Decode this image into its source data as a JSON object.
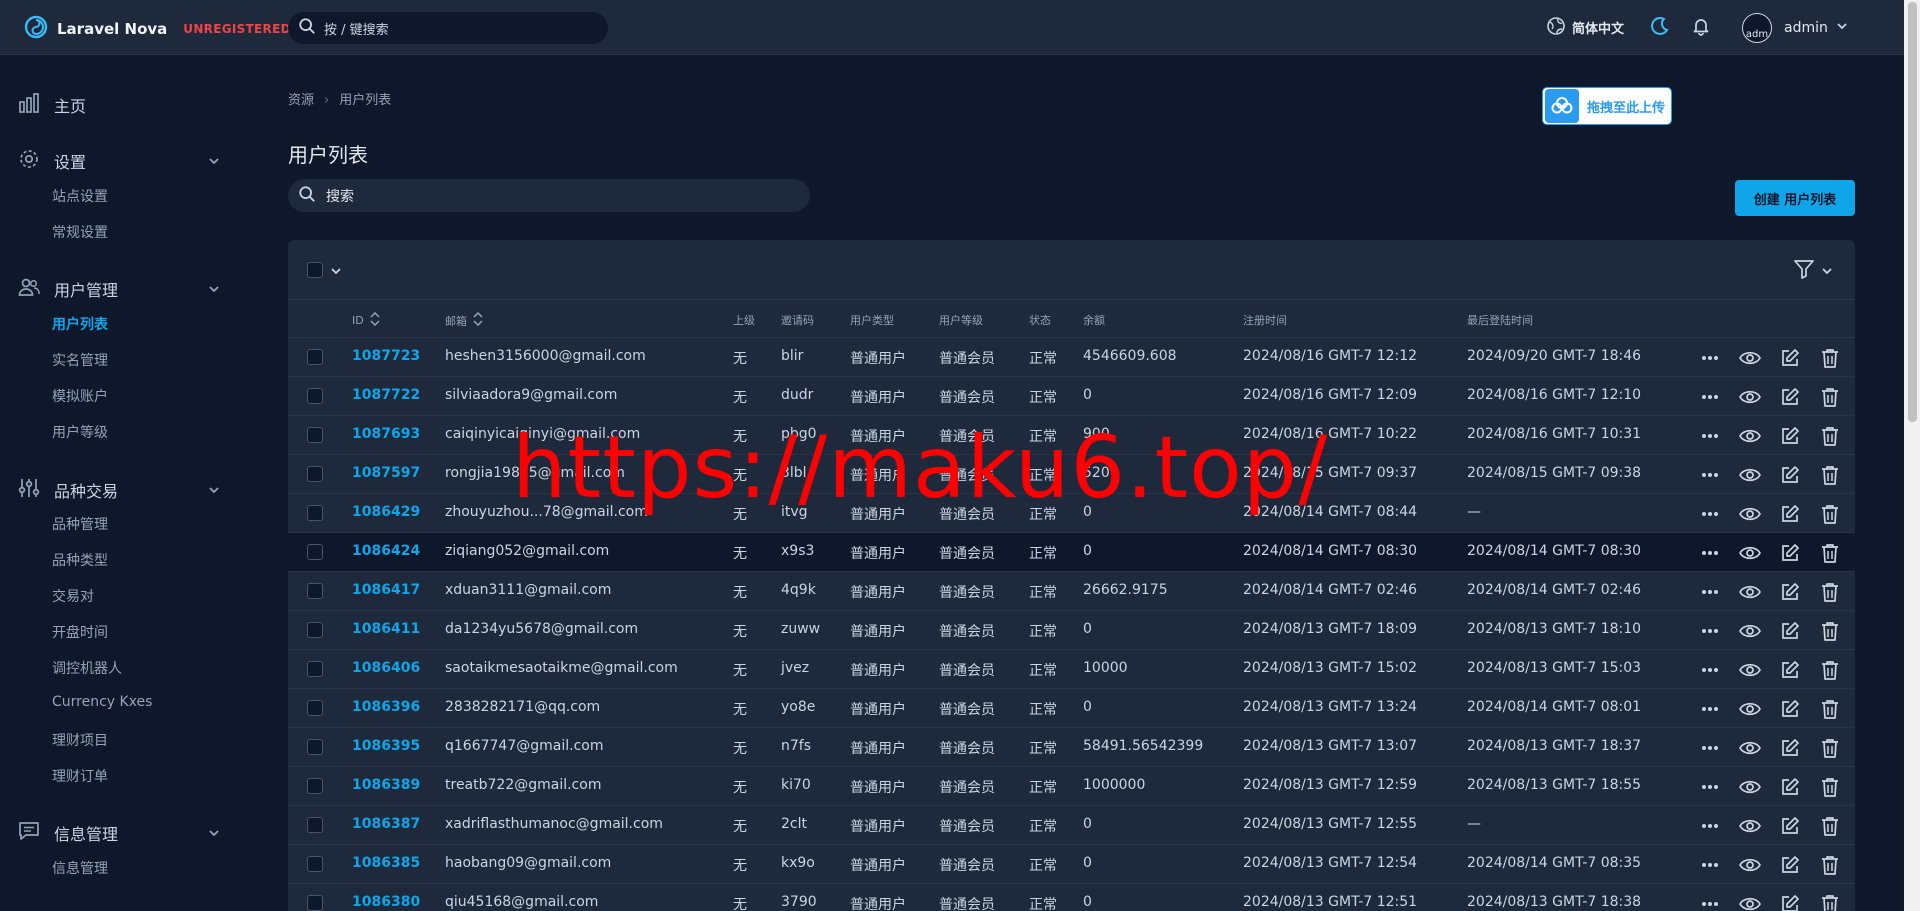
{
  "app": {
    "name": "Laravel Nova",
    "license": "UNREGISTERED"
  },
  "global_search": {
    "placeholder": "按 / 键搜索"
  },
  "header": {
    "language": "简体中文",
    "user": "admin",
    "avatar_alt": "adm"
  },
  "sidebar": {
    "home": "主页",
    "settings": {
      "label": "设置",
      "items": [
        "站点设置",
        "常规设置"
      ]
    },
    "users": {
      "label": "用户管理",
      "items": [
        "用户列表",
        "实名管理",
        "模拟账户",
        "用户等级"
      ]
    },
    "trading": {
      "label": "品种交易",
      "items": [
        "品种管理",
        "品种类型",
        "交易对",
        "开盘时间",
        "调控机器人",
        "Currency Kxes",
        "理财项目",
        "理财订单"
      ]
    },
    "messages": {
      "label": "信息管理",
      "items": [
        "信息管理"
      ]
    }
  },
  "breadcrumb": {
    "root": "资源",
    "current": "用户列表"
  },
  "upload": {
    "label": "拖拽至此上传"
  },
  "page": {
    "title": "用户列表",
    "search_placeholder": "搜索",
    "create_label": "创建 用户列表"
  },
  "columns": [
    "ID",
    "邮箱",
    "上级",
    "邀请码",
    "用户类型",
    "用户等级",
    "状态",
    "余额",
    "注册时间",
    "最后登陆时间"
  ],
  "rows": [
    {
      "id": "1087723",
      "email": "heshen3156000@gmail.com",
      "parent": "无",
      "code": "blir",
      "type": "普通用户",
      "level": "普通会员",
      "status": "正常",
      "balance": "4546609.608",
      "registered": "2024/08/16 GMT-7 12:12",
      "last_login": "2024/09/20 GMT-7 18:46"
    },
    {
      "id": "1087722",
      "email": "silviaadora9@gmail.com",
      "parent": "无",
      "code": "dudr",
      "type": "普通用户",
      "level": "普通会员",
      "status": "正常",
      "balance": "0",
      "registered": "2024/08/16 GMT-7 12:09",
      "last_login": "2024/08/16 GMT-7 12:10"
    },
    {
      "id": "1087693",
      "email": "caiqinyicaiqinyi@gmail.com",
      "parent": "无",
      "code": "pbg0",
      "type": "普通用户",
      "level": "普通会员",
      "status": "正常",
      "balance": "900",
      "registered": "2024/08/16 GMT-7 10:22",
      "last_login": "2024/08/16 GMT-7 10:31"
    },
    {
      "id": "1087597",
      "email": "rongjia19835@gmail.com",
      "parent": "无",
      "code": "3lbl",
      "type": "普通用户",
      "level": "普通会员",
      "status": "正常",
      "balance": "520",
      "registered": "2024/08/15 GMT-7 09:37",
      "last_login": "2024/08/15 GMT-7 09:38"
    },
    {
      "id": "1086429",
      "email": "zhouyuzhou...78@gmail.com",
      "parent": "无",
      "code": "itvg",
      "type": "普通用户",
      "level": "普通会员",
      "status": "正常",
      "balance": "0",
      "registered": "2024/08/14 GMT-7 08:44",
      "last_login": "—"
    },
    {
      "id": "1086424",
      "email": "ziqiang052@gmail.com",
      "parent": "无",
      "code": "x9s3",
      "type": "普通用户",
      "level": "普通会员",
      "status": "正常",
      "balance": "0",
      "registered": "2024/08/14 GMT-7 08:30",
      "last_login": "2024/08/14 GMT-7 08:30"
    },
    {
      "id": "1086417",
      "email": "xduan3111@gmail.com",
      "parent": "无",
      "code": "4q9k",
      "type": "普通用户",
      "level": "普通会员",
      "status": "正常",
      "balance": "26662.9175",
      "registered": "2024/08/14 GMT-7 02:46",
      "last_login": "2024/08/14 GMT-7 02:46"
    },
    {
      "id": "1086411",
      "email": "da1234yu5678@gmail.com",
      "parent": "无",
      "code": "zuww",
      "type": "普通用户",
      "level": "普通会员",
      "status": "正常",
      "balance": "0",
      "registered": "2024/08/13 GMT-7 18:09",
      "last_login": "2024/08/13 GMT-7 18:10"
    },
    {
      "id": "1086406",
      "email": "saotaikmesaotaikme@gmail.com",
      "parent": "无",
      "code": "jvez",
      "type": "普通用户",
      "level": "普通会员",
      "status": "正常",
      "balance": "10000",
      "registered": "2024/08/13 GMT-7 15:02",
      "last_login": "2024/08/13 GMT-7 15:03"
    },
    {
      "id": "1086396",
      "email": "2838282171@qq.com",
      "parent": "无",
      "code": "yo8e",
      "type": "普通用户",
      "level": "普通会员",
      "status": "正常",
      "balance": "0",
      "registered": "2024/08/13 GMT-7 13:24",
      "last_login": "2024/08/14 GMT-7 08:01"
    },
    {
      "id": "1086395",
      "email": "q1667747@gmail.com",
      "parent": "无",
      "code": "n7fs",
      "type": "普通用户",
      "level": "普通会员",
      "status": "正常",
      "balance": "58491.56542399",
      "registered": "2024/08/13 GMT-7 13:07",
      "last_login": "2024/08/13 GMT-7 18:37"
    },
    {
      "id": "1086389",
      "email": "treatb722@gmail.com",
      "parent": "无",
      "code": "ki70",
      "type": "普通用户",
      "level": "普通会员",
      "status": "正常",
      "balance": "1000000",
      "registered": "2024/08/13 GMT-7 12:59",
      "last_login": "2024/08/13 GMT-7 18:55"
    },
    {
      "id": "1086387",
      "email": "xadriflasthumanoc@gmail.com",
      "parent": "无",
      "code": "2clt",
      "type": "普通用户",
      "level": "普通会员",
      "status": "正常",
      "balance": "0",
      "registered": "2024/08/13 GMT-7 12:55",
      "last_login": "—"
    },
    {
      "id": "1086385",
      "email": "haobang09@gmail.com",
      "parent": "无",
      "code": "kx9o",
      "type": "普通用户",
      "level": "普通会员",
      "status": "正常",
      "balance": "0",
      "registered": "2024/08/13 GMT-7 12:54",
      "last_login": "2024/08/14 GMT-7 08:35"
    },
    {
      "id": "1086380",
      "email": "qiu45168@gmail.com",
      "parent": "无",
      "code": "3790",
      "type": "普通用户",
      "level": "普通会员",
      "status": "正常",
      "balance": "0",
      "registered": "2024/08/13 GMT-7 12:51",
      "last_login": "2024/08/13 GMT-7 18:38"
    }
  ],
  "watermark": "https://maku6.top/",
  "colors": {
    "accent": "#0ea5e9",
    "background": "#0f172a",
    "surface": "#1e293b",
    "warning": "#ef4444"
  }
}
